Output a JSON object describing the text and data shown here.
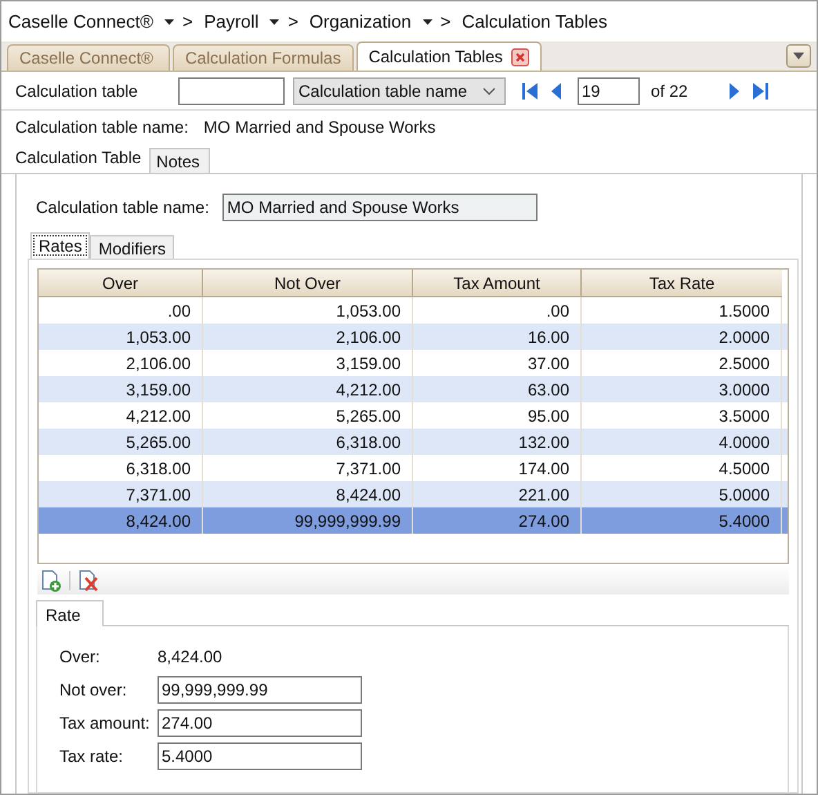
{
  "breadcrumb": {
    "separator": ">",
    "items": [
      {
        "label": "Caselle Connect®"
      },
      {
        "label": "Payroll"
      },
      {
        "label": "Organization"
      },
      {
        "label": "Calculation Tables"
      }
    ]
  },
  "doc_tabs": [
    {
      "label": "Caselle Connect®",
      "selected": false
    },
    {
      "label": "Calculation Formulas",
      "selected": false
    },
    {
      "label": "Calculation Tables",
      "selected": true
    }
  ],
  "toolbar": {
    "label": "Calculation table",
    "dropdown": "Calculation table name",
    "record": "19",
    "of_total": "of 22"
  },
  "name_line": {
    "label": "Calculation table name:",
    "value": "MO Married and Spouse Works"
  },
  "sub_tabs": [
    {
      "label": "Calculation Table",
      "selected": true
    },
    {
      "label": "Notes",
      "selected": false
    }
  ],
  "name_field": {
    "label": "Calculation table name:",
    "value": "MO Married and Spouse Works"
  },
  "grid_tabs": [
    {
      "label": "Rates",
      "selected": true
    },
    {
      "label": "Modifiers",
      "selected": false
    }
  ],
  "table": {
    "columns": [
      "Over",
      "Not Over",
      "Tax Amount",
      "Tax Rate"
    ],
    "rows": [
      {
        "cells": [
          ".00",
          "1,053.00",
          ".00",
          "1.5000"
        ],
        "selected": false
      },
      {
        "cells": [
          "1,053.00",
          "2,106.00",
          "16.00",
          "2.0000"
        ],
        "selected": false
      },
      {
        "cells": [
          "2,106.00",
          "3,159.00",
          "37.00",
          "2.5000"
        ],
        "selected": false
      },
      {
        "cells": [
          "3,159.00",
          "4,212.00",
          "63.00",
          "3.0000"
        ],
        "selected": false
      },
      {
        "cells": [
          "4,212.00",
          "5,265.00",
          "95.00",
          "3.5000"
        ],
        "selected": false
      },
      {
        "cells": [
          "5,265.00",
          "6,318.00",
          "132.00",
          "4.0000"
        ],
        "selected": false
      },
      {
        "cells": [
          "6,318.00",
          "7,371.00",
          "174.00",
          "4.5000"
        ],
        "selected": false
      },
      {
        "cells": [
          "7,371.00",
          "8,424.00",
          "221.00",
          "5.0000"
        ],
        "selected": false
      },
      {
        "cells": [
          "8,424.00",
          "99,999,999.99",
          "274.00",
          "5.4000"
        ],
        "selected": true
      }
    ]
  },
  "detail_tab": {
    "label": "Rate"
  },
  "detail": [
    {
      "kind": "static",
      "label": "Over:",
      "value": "8,424.00"
    },
    {
      "kind": "field",
      "label": "Not over:",
      "value": "99,999,999.99"
    },
    {
      "kind": "field",
      "label": "Tax amount:",
      "value": "274.00"
    },
    {
      "kind": "field",
      "label": "Tax rate:",
      "value": "5.4000"
    }
  ]
}
